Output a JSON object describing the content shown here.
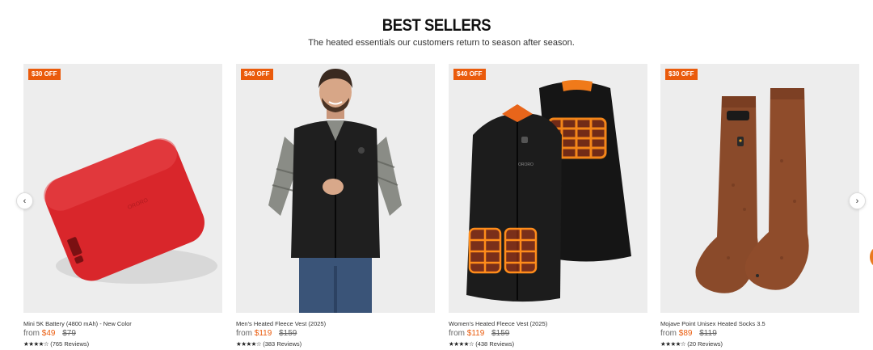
{
  "section": {
    "title": "BEST SELLERS",
    "subtitle": "The heated essentials our customers return to season after season."
  },
  "colors": {
    "accent": "#ea5b0c",
    "card_bg": "#ededed"
  },
  "nav": {
    "prev_icon": "chevron-left-icon",
    "next_icon": "chevron-right-icon",
    "prev_glyph": "‹",
    "next_glyph": "›"
  },
  "products": [
    {
      "badge": "$30 OFF",
      "name": "Mini 5K Battery (4800 mAh) - New Color",
      "from_label": "from",
      "price": "$49",
      "compare_price": "$79",
      "stars": "★★★★☆",
      "rating": 4.5,
      "reviews": "(765 Reviews)",
      "image": "red-battery-pack"
    },
    {
      "badge": "$40 OFF",
      "name": "Men's Heated Fleece Vest (2025)",
      "from_label": "from",
      "price": "$119",
      "compare_price": "$159",
      "stars": "★★★★☆",
      "rating": 4.5,
      "reviews": "(383 Reviews)",
      "image": "man-in-black-fleece-vest"
    },
    {
      "badge": "$40 OFF",
      "name": "Women's Heated Fleece Vest (2025)",
      "from_label": "from",
      "price": "$119",
      "compare_price": "$159",
      "stars": "★★★★☆",
      "rating": 4.5,
      "reviews": "(438 Reviews)",
      "image": "womens-vest-heating-zones"
    },
    {
      "badge": "$30 OFF",
      "name": "Mojave Point Unisex Heated Socks 3.5",
      "from_label": "from",
      "price": "$89",
      "compare_price": "$119",
      "stars": "★★★★☆",
      "rating": 4,
      "reviews": "(20 Reviews)",
      "image": "brown-heated-socks"
    }
  ]
}
